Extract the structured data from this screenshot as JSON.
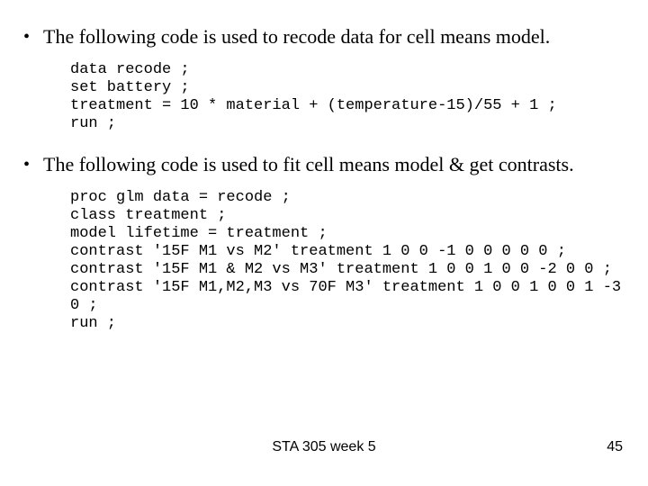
{
  "bullets": [
    {
      "text": "The following code is used to recode data for cell means model.",
      "code": "data recode ;\nset battery ;\ntreatment = 10 * material + (temperature-15)/55 + 1 ;\nrun ;"
    },
    {
      "text": "The following code is used to fit cell means model & get contrasts.",
      "code": "proc glm data = recode ;\nclass treatment ;\nmodel lifetime = treatment ;\ncontrast '15F M1 vs M2' treatment 1 0 0 -1 0 0 0 0 0 ;\ncontrast '15F M1 & M2 vs M3' treatment 1 0 0 1 0 0 -2 0 0 ;\ncontrast '15F M1,M2,M3 vs 70F M3' treatment 1 0 0 1 0 0 1 -3 0 ;\nrun ;"
    }
  ],
  "footer": {
    "center": "STA 305 week 5",
    "page": "45"
  }
}
